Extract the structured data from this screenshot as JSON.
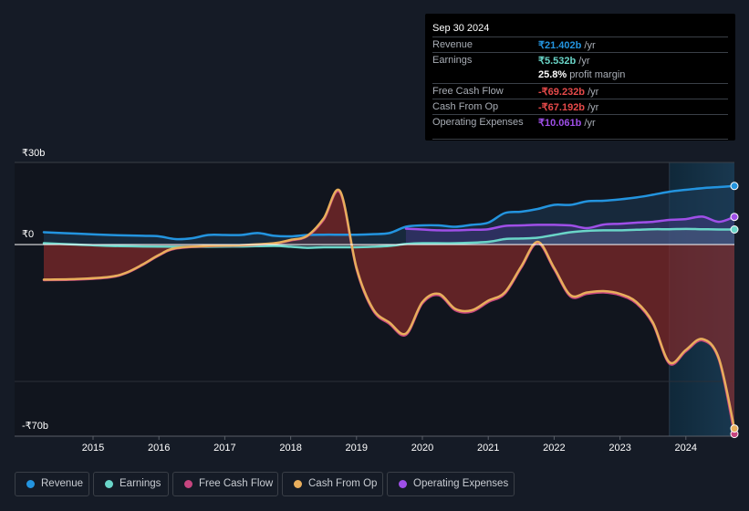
{
  "tooltip": {
    "date": "Sep 30 2024",
    "rows": [
      {
        "label": "Revenue",
        "value": "₹21.402b",
        "unit": " /yr",
        "color": "#2394df"
      },
      {
        "label": "Earnings",
        "value": "₹5.532b",
        "unit": " /yr",
        "color": "#6ad5c8"
      },
      {
        "label": "",
        "value": "25.8%",
        "unit": " profit margin",
        "color": "#ffffff"
      },
      {
        "label": "Free Cash Flow",
        "value": "-₹69.232b",
        "unit": " /yr",
        "color": "#e64a4a"
      },
      {
        "label": "Cash From Op",
        "value": "-₹67.192b",
        "unit": " /yr",
        "color": "#e64a4a"
      },
      {
        "label": "Operating Expenses",
        "value": "₹10.061b",
        "unit": " /yr",
        "color": "#9f4fe8"
      }
    ]
  },
  "legend": [
    {
      "label": "Revenue",
      "color": "#2394df"
    },
    {
      "label": "Earnings",
      "color": "#6ad5c8"
    },
    {
      "label": "Free Cash Flow",
      "color": "#c6457f"
    },
    {
      "label": "Cash From Op",
      "color": "#e8ae5c"
    },
    {
      "label": "Operating Expenses",
      "color": "#9f4fe8"
    }
  ],
  "chart_data": {
    "type": "line",
    "title": "",
    "xlabel": "",
    "ylabel": "",
    "y_tick_labels": [
      "₹30b",
      "₹0",
      "-₹70b"
    ],
    "y_ticks": [
      30,
      0,
      -70
    ],
    "ylim": [
      -70,
      30
    ],
    "xlim": [
      2014.2,
      2024.75
    ],
    "x_tick_labels": [
      "2015",
      "2016",
      "2017",
      "2018",
      "2019",
      "2020",
      "2021",
      "2022",
      "2023",
      "2024"
    ],
    "x_ticks": [
      2015,
      2016,
      2017,
      2018,
      2019,
      2020,
      2021,
      2022,
      2023,
      2024
    ],
    "highlight_from": 2023.75,
    "grid": true,
    "legend_position": "bottom",
    "series": [
      {
        "name": "Revenue",
        "color": "#2394df",
        "x": [
          2014.25,
          2014.75,
          2015.25,
          2015.75,
          2016.0,
          2016.25,
          2016.5,
          2016.75,
          2017.0,
          2017.25,
          2017.5,
          2017.75,
          2018.0,
          2018.25,
          2018.5,
          2018.75,
          2019.0,
          2019.25,
          2019.5,
          2019.75,
          2020.0,
          2020.25,
          2020.5,
          2020.75,
          2021.0,
          2021.25,
          2021.5,
          2021.75,
          2022.0,
          2022.25,
          2022.5,
          2022.75,
          2023.0,
          2023.25,
          2023.5,
          2023.75,
          2024.0,
          2024.25,
          2024.5,
          2024.75
        ],
        "values": [
          4.5,
          4.0,
          3.5,
          3.2,
          3.0,
          2.0,
          2.3,
          3.5,
          3.5,
          3.5,
          4.2,
          3.2,
          3.0,
          3.5,
          3.6,
          3.6,
          3.6,
          3.8,
          4.2,
          6.5,
          7.0,
          7.0,
          6.5,
          7.2,
          8.0,
          11.5,
          12.0,
          13.0,
          14.5,
          14.5,
          15.8,
          16.0,
          16.5,
          17.2,
          18.2,
          19.3,
          20.0,
          20.6,
          21.0,
          21.4
        ]
      },
      {
        "name": "Earnings",
        "color": "#6ad5c8",
        "x": [
          2014.25,
          2014.75,
          2015.25,
          2015.75,
          2016.25,
          2016.75,
          2017.25,
          2017.75,
          2018.0,
          2018.25,
          2018.5,
          2018.75,
          2019.0,
          2019.25,
          2019.5,
          2019.75,
          2020.0,
          2020.5,
          2021.0,
          2021.25,
          2021.5,
          2021.75,
          2022.0,
          2022.25,
          2022.5,
          2022.75,
          2023.0,
          2023.25,
          2023.5,
          2023.75,
          2024.0,
          2024.25,
          2024.5,
          2024.75
        ],
        "values": [
          0.5,
          0.0,
          -0.5,
          -0.7,
          -0.8,
          -0.8,
          -0.7,
          -0.5,
          -0.8,
          -1.2,
          -1.0,
          -1.0,
          -1.0,
          -0.8,
          -0.5,
          0.2,
          0.5,
          0.5,
          1.0,
          2.0,
          2.2,
          2.5,
          3.5,
          4.5,
          5.0,
          5.2,
          5.2,
          5.4,
          5.6,
          5.6,
          5.7,
          5.6,
          5.5,
          5.5
        ]
      },
      {
        "name": "Free Cash Flow",
        "color": "#c6457f",
        "x": [
          2014.25,
          2014.75,
          2015.25,
          2015.5,
          2015.75,
          2016.0,
          2016.25,
          2016.75,
          2017.25,
          2017.75,
          2018.0,
          2018.25,
          2018.5,
          2018.75,
          2019.0,
          2019.25,
          2019.5,
          2019.75,
          2020.0,
          2020.25,
          2020.5,
          2020.75,
          2021.0,
          2021.25,
          2021.5,
          2021.75,
          2022.0,
          2022.25,
          2022.5,
          2022.75,
          2023.0,
          2023.25,
          2023.5,
          2023.75,
          2024.0,
          2024.25,
          2024.5,
          2024.75
        ],
        "values": [
          -13,
          -12.8,
          -12.0,
          -10.5,
          -7.5,
          -4.0,
          -1.5,
          -0.6,
          -0.3,
          0.4,
          1.5,
          3.0,
          9.0,
          19.0,
          -9.0,
          -24.0,
          -29.0,
          -33.0,
          -21.5,
          -18.5,
          -24.0,
          -24.5,
          -21.0,
          -18.0,
          -8.5,
          0.5,
          -9.0,
          -19.0,
          -18.0,
          -17.5,
          -18.5,
          -21.5,
          -29.0,
          -43.5,
          -39.0,
          -35.0,
          -42.0,
          -69.2
        ]
      },
      {
        "name": "Cash From Op",
        "color": "#e8ae5c",
        "x": [
          2014.25,
          2014.75,
          2015.25,
          2015.5,
          2015.75,
          2016.0,
          2016.25,
          2016.75,
          2017.25,
          2017.75,
          2018.0,
          2018.25,
          2018.5,
          2018.75,
          2019.0,
          2019.25,
          2019.5,
          2019.75,
          2020.0,
          2020.25,
          2020.5,
          2020.75,
          2021.0,
          2021.25,
          2021.5,
          2021.75,
          2022.0,
          2022.25,
          2022.5,
          2022.75,
          2023.0,
          2023.25,
          2023.5,
          2023.75,
          2024.0,
          2024.25,
          2024.5,
          2024.75
        ],
        "values": [
          -12.8,
          -12.6,
          -11.8,
          -10.3,
          -7.3,
          -3.8,
          -1.3,
          -0.5,
          -0.2,
          0.5,
          1.7,
          3.2,
          9.5,
          19.5,
          -8.5,
          -23.5,
          -28.5,
          -32.5,
          -21.0,
          -18.0,
          -23.5,
          -24.0,
          -20.5,
          -17.5,
          -8.0,
          1.0,
          -8.5,
          -18.5,
          -17.5,
          -17.0,
          -18.0,
          -21.0,
          -28.5,
          -43.0,
          -38.5,
          -34.5,
          -41.5,
          -67.2
        ]
      },
      {
        "name": "Operating Expenses",
        "color": "#9f4fe8",
        "x": [
          2019.75,
          2020.0,
          2020.25,
          2020.5,
          2020.75,
          2021.0,
          2021.25,
          2021.5,
          2021.75,
          2022.0,
          2022.25,
          2022.5,
          2022.75,
          2023.0,
          2023.25,
          2023.5,
          2023.75,
          2024.0,
          2024.25,
          2024.5,
          2024.75
        ],
        "values": [
          5.8,
          5.5,
          5.2,
          5.2,
          5.4,
          5.6,
          6.8,
          7.0,
          7.2,
          7.2,
          7.0,
          6.0,
          7.3,
          7.6,
          8.0,
          8.3,
          9.0,
          9.3,
          10.2,
          8.3,
          10.1
        ]
      }
    ]
  }
}
